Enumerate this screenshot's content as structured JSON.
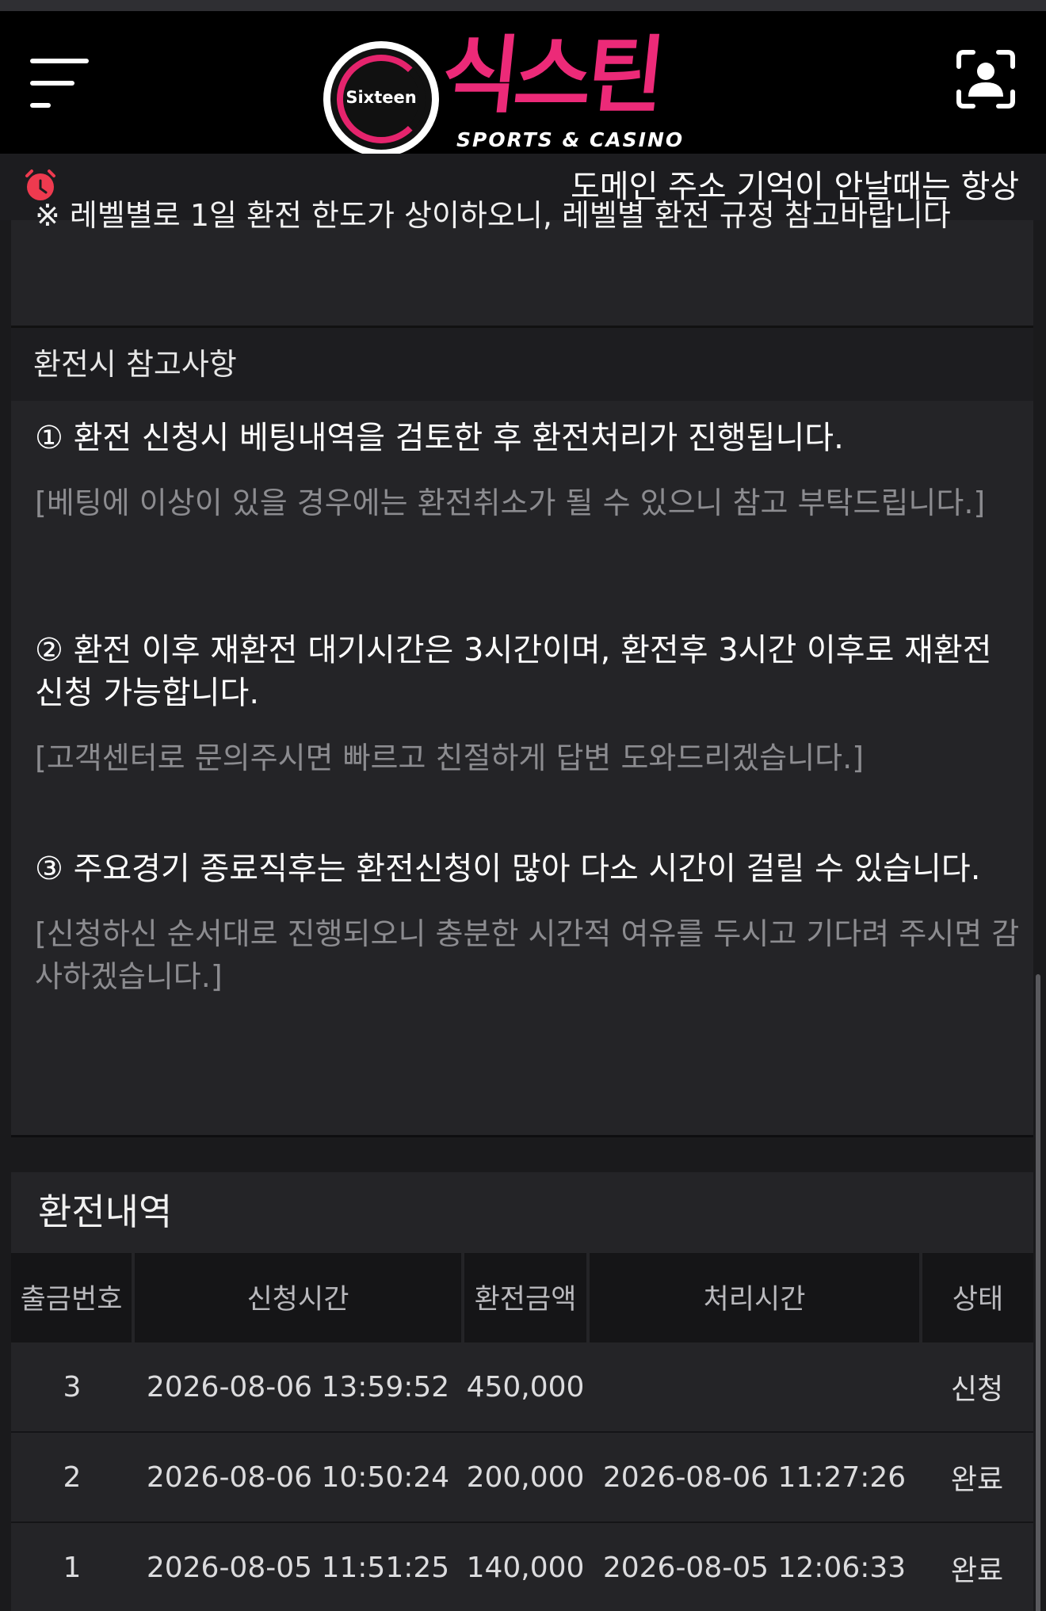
{
  "header": {
    "logo_circle_text": "Sixteen",
    "logo_kr": "식스틴",
    "logo_sub": "SPORTS & CASINO"
  },
  "notice": {
    "text": "도메인 주소 기억이 안날때는 항상"
  },
  "top_note": {
    "text": "※ 레벨별로 1일 환전 한도가 상이하오니, 레벨별 환전 규정 참고바랍니다"
  },
  "reference": {
    "title": "환전시 참고사항",
    "items": [
      {
        "main": "① 환전 신청시 베팅내역을 검토한 후 환전처리가 진행됩니다.",
        "sub": "[베팅에 이상이 있을 경우에는 환전취소가 될 수 있으니 참고 부탁드립니다.]"
      },
      {
        "main": "② 환전 이후 재환전 대기시간은 3시간이며, 환전후 3시간 이후로 재환전 신청 가능합니다.",
        "sub": "[고객센터로 문의주시면 빠르고 친절하게 답변 도와드리겠습니다.]"
      },
      {
        "main": "③ 주요경기 종료직후는 환전신청이 많아 다소 시간이 걸릴 수 있습니다.",
        "sub": "[신청하신 순서대로 진행되오니 충분한 시간적 여유를 두시고 기다려 주시면 감사하겠습니다.]"
      }
    ]
  },
  "history": {
    "title": "환전내역",
    "columns": [
      "출금번호",
      "신청시간",
      "환전금액",
      "처리시간",
      "상태"
    ],
    "rows": [
      [
        "3",
        "2026-08-06 13:59:52",
        "450,000",
        "",
        "신청"
      ],
      [
        "2",
        "2026-08-06 10:50:24",
        "200,000",
        "2026-08-06 11:27:26",
        "완료"
      ],
      [
        "1",
        "2026-08-05 11:51:25",
        "140,000",
        "2026-08-05 12:06:33",
        "완료"
      ]
    ]
  },
  "colors": {
    "brand_pink": "#ec2a78",
    "background": "#1a1a1c",
    "panel": "#242427"
  },
  "icons": {
    "menu": "hamburger-icon",
    "user": "user-scan-icon",
    "bell": "bell-icon"
  }
}
